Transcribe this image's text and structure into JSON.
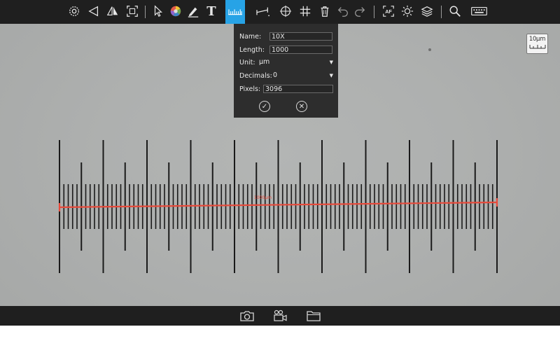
{
  "toolbar": {
    "items": [
      {
        "name": "settings-icon",
        "interactable": true
      },
      {
        "name": "exposure-icon",
        "interactable": true
      },
      {
        "name": "mirror-icon",
        "interactable": true
      },
      {
        "name": "fit-window-icon",
        "interactable": true
      },
      {
        "name": "cursor-icon",
        "interactable": true
      },
      {
        "name": "color-wheel-icon",
        "interactable": true
      },
      {
        "name": "pen-icon",
        "interactable": true
      },
      {
        "name": "text-icon",
        "interactable": true,
        "glyph": "T"
      },
      {
        "name": "calibration-ruler-icon",
        "interactable": true,
        "active": true
      },
      {
        "name": "line-measure-icon",
        "interactable": true
      },
      {
        "name": "crosshair-icon",
        "interactable": true
      },
      {
        "name": "grid-icon",
        "interactable": true
      },
      {
        "name": "trash-icon",
        "interactable": true
      },
      {
        "name": "undo-icon",
        "interactable": true
      },
      {
        "name": "redo-icon",
        "interactable": true
      },
      {
        "name": "autofocus-icon",
        "interactable": true,
        "glyph": "AF"
      },
      {
        "name": "brightness-icon",
        "interactable": true
      },
      {
        "name": "layers-icon",
        "interactable": true
      },
      {
        "name": "zoom-icon",
        "interactable": true
      },
      {
        "name": "keyboard-icon",
        "interactable": true
      }
    ]
  },
  "calibration": {
    "name_label": "Name:",
    "name_value": "10X",
    "length_label": "Length:",
    "length_value": "1000",
    "unit_label": "Unit:",
    "unit_value": "µm",
    "decimals_label": "Decimals:",
    "decimals_value": "0",
    "pixels_label": "Pixels:",
    "pixels_value": "3096",
    "confirm_glyph": "✓",
    "cancel_glyph": "✕"
  },
  "scale_badge": {
    "text": "10µm"
  },
  "measurement": {
    "label": "1000µm"
  },
  "bottombar": {
    "items": [
      {
        "name": "camera-icon"
      },
      {
        "name": "video-record-icon"
      },
      {
        "name": "folder-icon"
      }
    ]
  },
  "colors": {
    "toolbar_bg": "#1f1f1f",
    "active_tool": "#27a3e6",
    "measure_line": "#e74a3b",
    "panel_bg": "#2d2d2d"
  }
}
